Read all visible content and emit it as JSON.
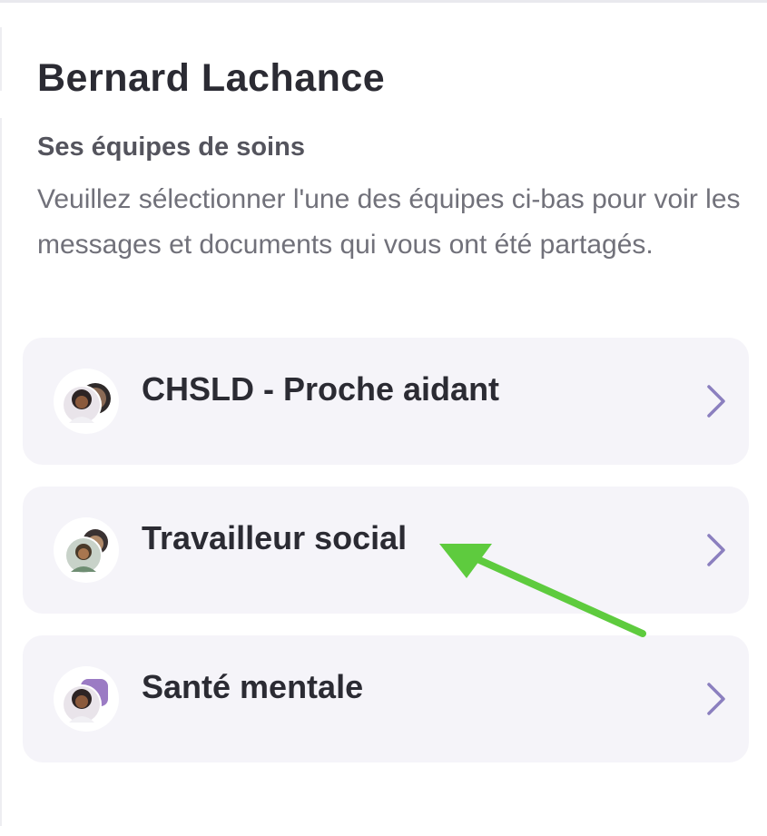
{
  "patient": {
    "name": "Bernard Lachance"
  },
  "care_teams": {
    "heading": "Ses équipes de soins",
    "description": "Veuillez sélectionner l'une des équipes ci-bas pour voir les messages et documents qui vous ont été partagés.",
    "teams": [
      {
        "label": "CHSLD - Proche aidant"
      },
      {
        "label": "Travailleur social"
      },
      {
        "label": "Santé mentale"
      }
    ]
  },
  "colors": {
    "card_background": "#f5f4f9",
    "chevron": "#8b7fbf",
    "annotation_arrow": "#5ecb3e"
  },
  "icons": {
    "team_avatar": "avatar-group-icon",
    "chevron": "chevron-right-icon",
    "annotation": "green-arrow-pointer"
  }
}
